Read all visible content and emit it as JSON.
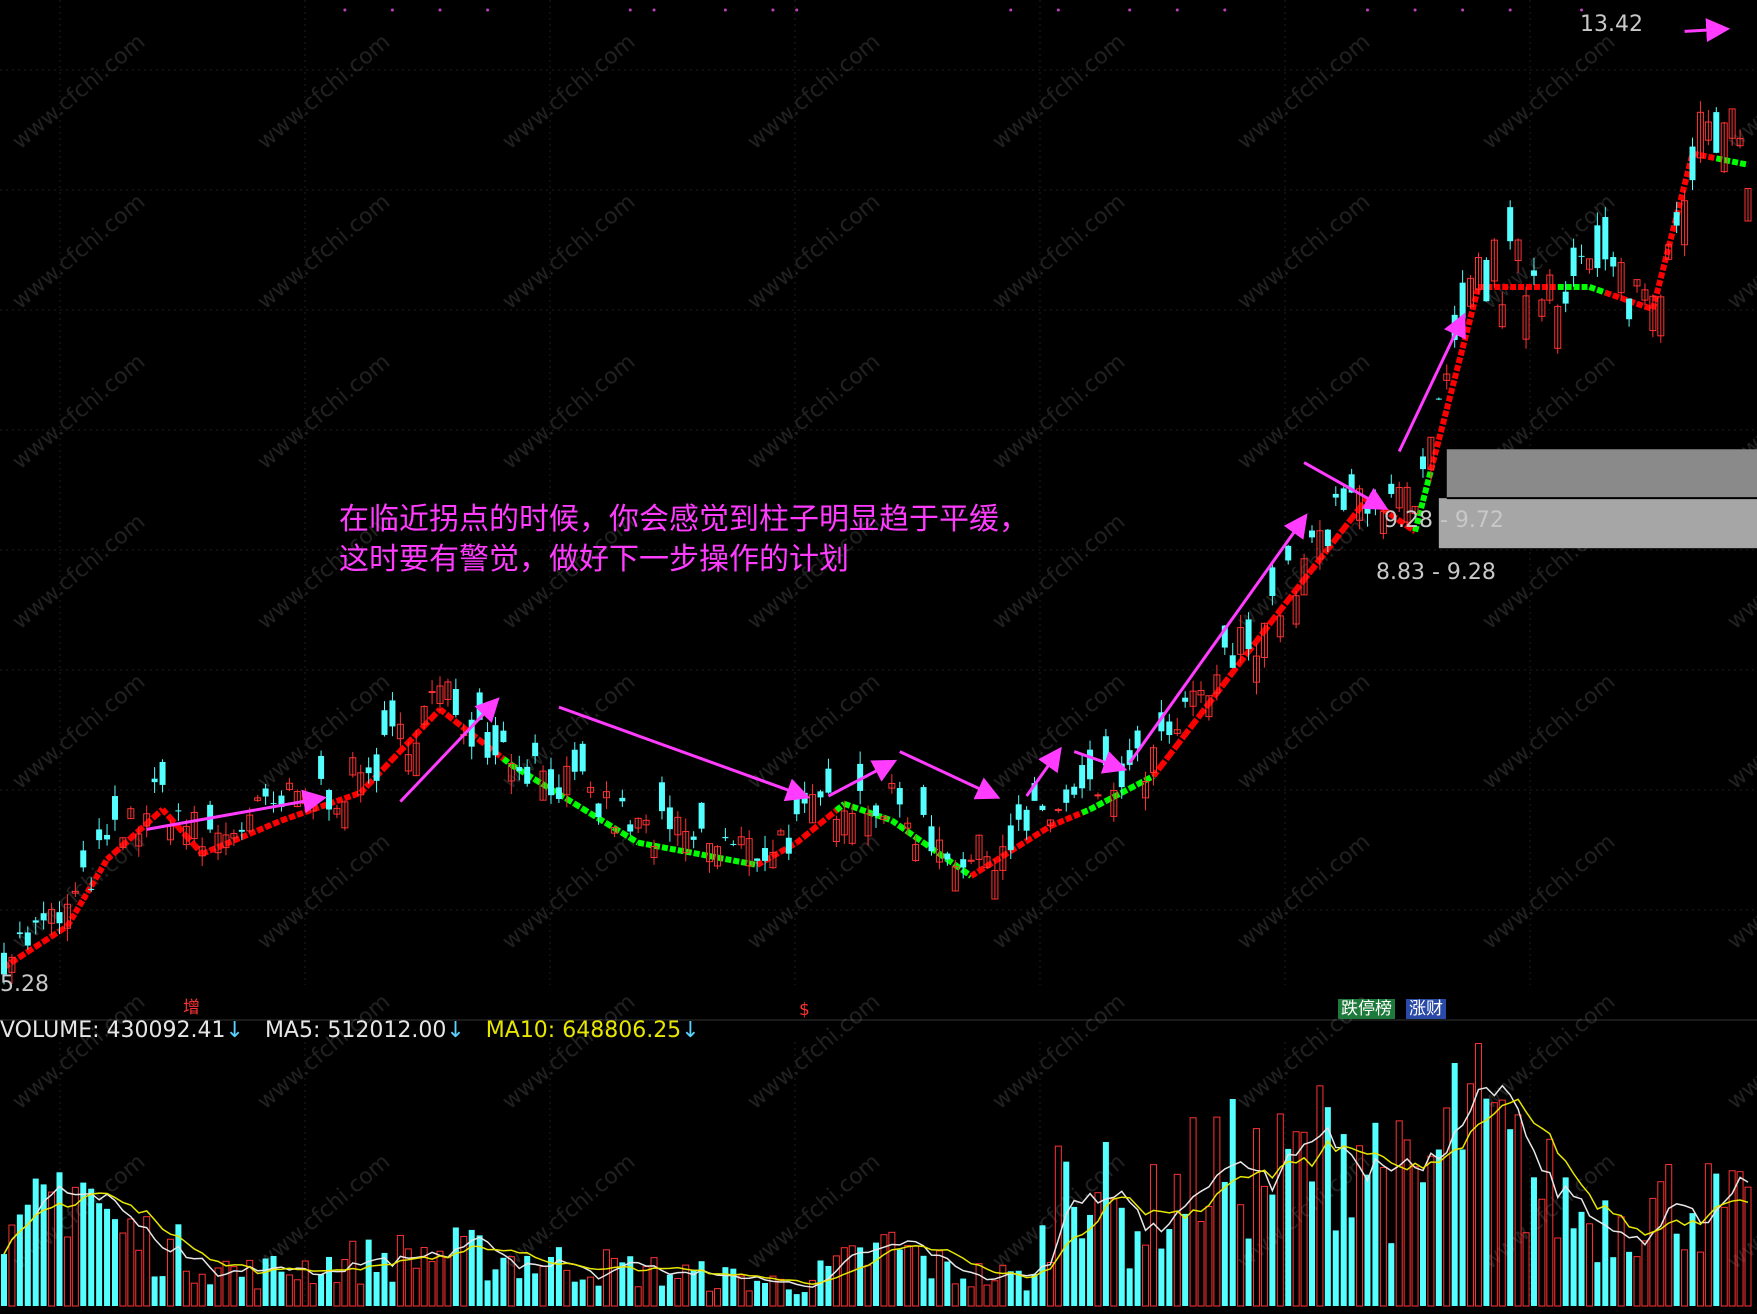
{
  "chart_data": {
    "type": "candlestick",
    "price_panel": {
      "ylim": [
        4.9,
        13.6
      ],
      "high_label": "13.42",
      "low_label": "5.28",
      "zones": [
        {
          "label": "9.28 - 9.72",
          "low": 9.28,
          "high": 9.72
        },
        {
          "label": "8.83 - 9.28",
          "low": 8.83,
          "high": 9.28
        }
      ],
      "line_colors": {
        "rising": "#ff0000",
        "falling": "#00ff00"
      },
      "candle_colors": {
        "up": "#ff3232",
        "down": "#54ffff"
      },
      "annotation_lines": [
        "在临近拐点的时候，你会感觉到柱子明显趋于平缓，",
        "这时要有警觉，做好下一步操作的计划"
      ],
      "annotation_color": "#ff3cff",
      "trend_anchors": [
        {
          "bar": 0,
          "price": 5.18
        },
        {
          "bar": 8,
          "price": 5.55
        },
        {
          "bar": 13,
          "price": 6.15
        },
        {
          "bar": 20,
          "price": 6.6
        },
        {
          "bar": 25,
          "price": 6.2
        },
        {
          "bar": 35,
          "price": 6.5
        },
        {
          "bar": 45,
          "price": 6.75
        },
        {
          "bar": 55,
          "price": 7.5
        },
        {
          "bar": 64,
          "price": 7.0
        },
        {
          "bar": 80,
          "price": 6.3
        },
        {
          "bar": 95,
          "price": 6.1
        },
        {
          "bar": 100,
          "price": 6.3
        },
        {
          "bar": 106,
          "price": 6.65
        },
        {
          "bar": 112,
          "price": 6.5
        },
        {
          "bar": 122,
          "price": 6.0
        },
        {
          "bar": 132,
          "price": 6.45
        },
        {
          "bar": 137,
          "price": 6.6
        },
        {
          "bar": 145,
          "price": 6.9
        },
        {
          "bar": 160,
          "price": 8.3
        },
        {
          "bar": 172,
          "price": 9.4
        },
        {
          "bar": 178,
          "price": 9.1
        },
        {
          "bar": 186,
          "price": 11.3
        },
        {
          "bar": 200,
          "price": 11.3
        },
        {
          "bar": 208,
          "price": 11.1
        },
        {
          "bar": 213,
          "price": 12.5
        },
        {
          "bar": 220,
          "price": 12.4
        }
      ],
      "turn_points_falling": [
        [
          64,
          95
        ],
        [
          106,
          122
        ],
        [
          137,
          145
        ],
        [
          179,
          180
        ],
        [
          197,
          202
        ],
        [
          217,
          220
        ]
      ],
      "arrows": [
        {
          "from": [
            18,
            6.3
          ],
          "to": [
            40,
            6.58
          ]
        },
        {
          "from": [
            50,
            6.55
          ],
          "to": [
            62,
            7.45
          ]
        },
        {
          "from": [
            70,
            7.4
          ],
          "to": [
            101,
            6.6
          ]
        },
        {
          "from": [
            104,
            6.6
          ],
          "to": [
            112,
            6.9
          ]
        },
        {
          "from": [
            113,
            7.0
          ],
          "to": [
            125,
            6.6
          ]
        },
        {
          "from": [
            129,
            6.6
          ],
          "to": [
            133,
            7.0
          ]
        },
        {
          "from": [
            135,
            7.0
          ],
          "to": [
            141,
            6.85
          ]
        },
        {
          "from": [
            142,
            6.9
          ],
          "to": [
            164,
            9.1
          ]
        },
        {
          "from": [
            164,
            9.6
          ],
          "to": [
            174,
            9.2
          ]
        },
        {
          "from": [
            176,
            9.7
          ],
          "to": [
            184,
            10.9
          ]
        },
        {
          "from": [
            212,
            13.48
          ],
          "to": [
            217,
            13.5
          ]
        }
      ]
    },
    "volume_panel": {
      "title": "VOLUME",
      "volume_label": "VOLUME: 430092.41",
      "ma5_label": "MA5: 512012.00",
      "ma10_label": "MA10: 648806.25",
      "ylim": [
        0,
        2300000
      ],
      "ma5_color": "#e6e6e6",
      "ma10_color": "#e6e600",
      "anchors": [
        {
          "bar": 0,
          "value": 400000
        },
        {
          "bar": 9,
          "value": 1300000
        },
        {
          "bar": 14,
          "value": 700000
        },
        {
          "bar": 30,
          "value": 300000
        },
        {
          "bar": 55,
          "value": 500000
        },
        {
          "bar": 70,
          "value": 400000
        },
        {
          "bar": 100,
          "value": 200000
        },
        {
          "bar": 112,
          "value": 550000
        },
        {
          "bar": 120,
          "value": 300000
        },
        {
          "bar": 130,
          "value": 250000
        },
        {
          "bar": 134,
          "value": 1500000
        },
        {
          "bar": 142,
          "value": 700000
        },
        {
          "bar": 152,
          "value": 1300000
        },
        {
          "bar": 160,
          "value": 1200000
        },
        {
          "bar": 170,
          "value": 1600000
        },
        {
          "bar": 178,
          "value": 1000000
        },
        {
          "bar": 184,
          "value": 1800000
        },
        {
          "bar": 192,
          "value": 1200000
        },
        {
          "bar": 200,
          "value": 800000
        },
        {
          "bar": 212,
          "value": 1000000
        },
        {
          "bar": 220,
          "value": 800000
        }
      ]
    },
    "n_bars": 221,
    "markers": [
      {
        "label": "增",
        "color": "#ff3232",
        "bar": 24
      },
      {
        "label": "$",
        "color": "#ff3232",
        "bar": 101
      },
      {
        "label": "跌停榜",
        "color": "#ffffff",
        "bg": "#1e7a3a",
        "bar": 171
      },
      {
        "label": "涨财",
        "color": "#ffffff",
        "bg": "#2a4aa8",
        "bar": 180
      }
    ],
    "watermark": "www.cfchi.com",
    "grid": true,
    "grid_color": "#1e1e1e"
  }
}
